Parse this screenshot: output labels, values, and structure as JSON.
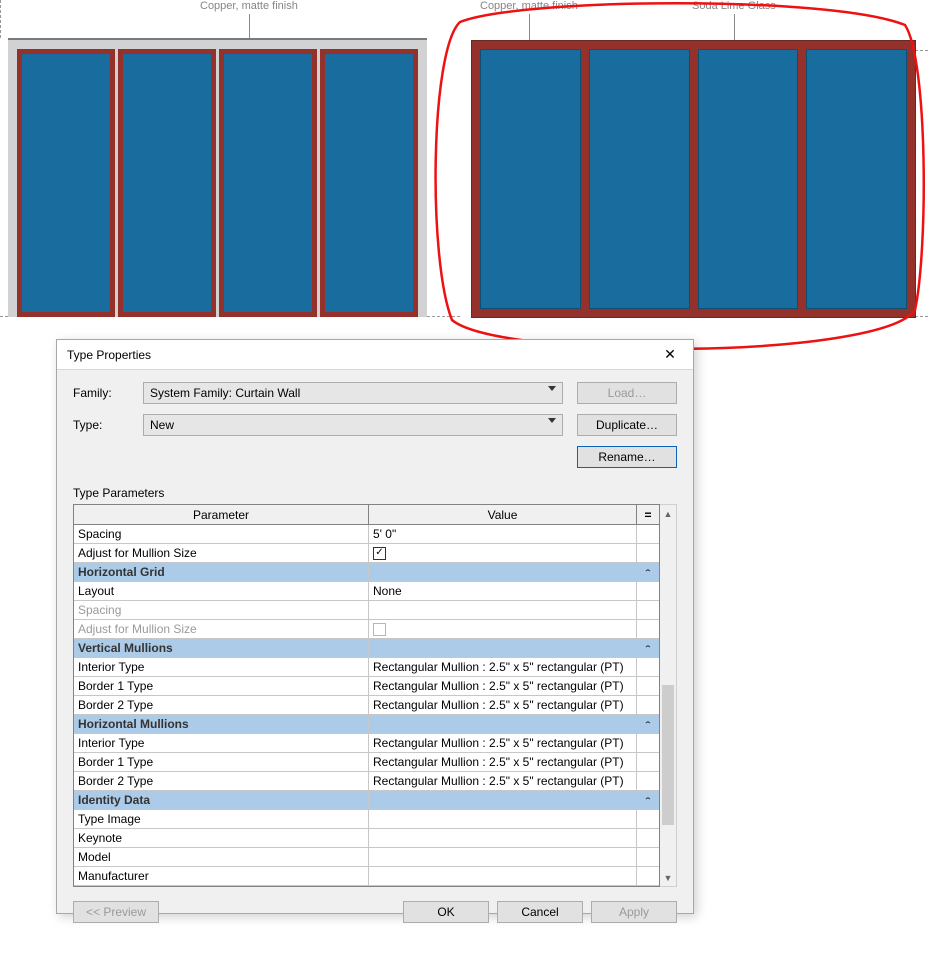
{
  "canvas": {
    "tag_copper": "Copper, matte finish",
    "tag_glass": "Soda Lime Glass"
  },
  "dialog": {
    "title": "Type Properties",
    "close_glyph": "✕",
    "family_label": "Family:",
    "family_value": "System Family: Curtain Wall",
    "type_label": "Type:",
    "type_value": "New",
    "load_label": "Load…",
    "duplicate_label": "Duplicate…",
    "rename_label": "Rename…",
    "type_params_label": "Type Parameters",
    "head_param": "Parameter",
    "head_value": "Value",
    "head_eq": "=",
    "rows": [
      {
        "kind": "data",
        "param": "Spacing",
        "value": "5'   0\""
      },
      {
        "kind": "data",
        "param": "Adjust for Mullion Size",
        "value": "",
        "check": true
      },
      {
        "kind": "section",
        "param": "Horizontal Grid"
      },
      {
        "kind": "data",
        "param": "Layout",
        "value": "None"
      },
      {
        "kind": "disabled",
        "param": "Spacing",
        "value": ""
      },
      {
        "kind": "disabled",
        "param": "Adjust for Mullion Size",
        "value": "",
        "check": false
      },
      {
        "kind": "section",
        "param": "Vertical Mullions"
      },
      {
        "kind": "data",
        "param": "Interior Type",
        "value": "Rectangular Mullion : 2.5\" x 5\" rectangular (PT)"
      },
      {
        "kind": "data",
        "param": "Border 1 Type",
        "value": "Rectangular Mullion : 2.5\" x 5\" rectangular (PT)"
      },
      {
        "kind": "data",
        "param": "Border 2 Type",
        "value": "Rectangular Mullion : 2.5\" x 5\" rectangular (PT)"
      },
      {
        "kind": "section",
        "param": "Horizontal Mullions"
      },
      {
        "kind": "data",
        "param": "Interior Type",
        "value": "Rectangular Mullion : 2.5\" x 5\" rectangular (PT)"
      },
      {
        "kind": "data",
        "param": "Border 1 Type",
        "value": "Rectangular Mullion : 2.5\" x 5\" rectangular (PT)"
      },
      {
        "kind": "data",
        "param": "Border 2 Type",
        "value": "Rectangular Mullion : 2.5\" x 5\" rectangular (PT)"
      },
      {
        "kind": "section",
        "param": "Identity Data"
      },
      {
        "kind": "data",
        "param": "Type Image",
        "value": ""
      },
      {
        "kind": "data",
        "param": "Keynote",
        "value": ""
      },
      {
        "kind": "data",
        "param": "Model",
        "value": ""
      },
      {
        "kind": "data",
        "param": "Manufacturer",
        "value": ""
      }
    ],
    "preview_label": "<< Preview",
    "ok_label": "OK",
    "cancel_label": "Cancel",
    "apply_label": "Apply",
    "section_collapse_glyph": "⌃"
  }
}
